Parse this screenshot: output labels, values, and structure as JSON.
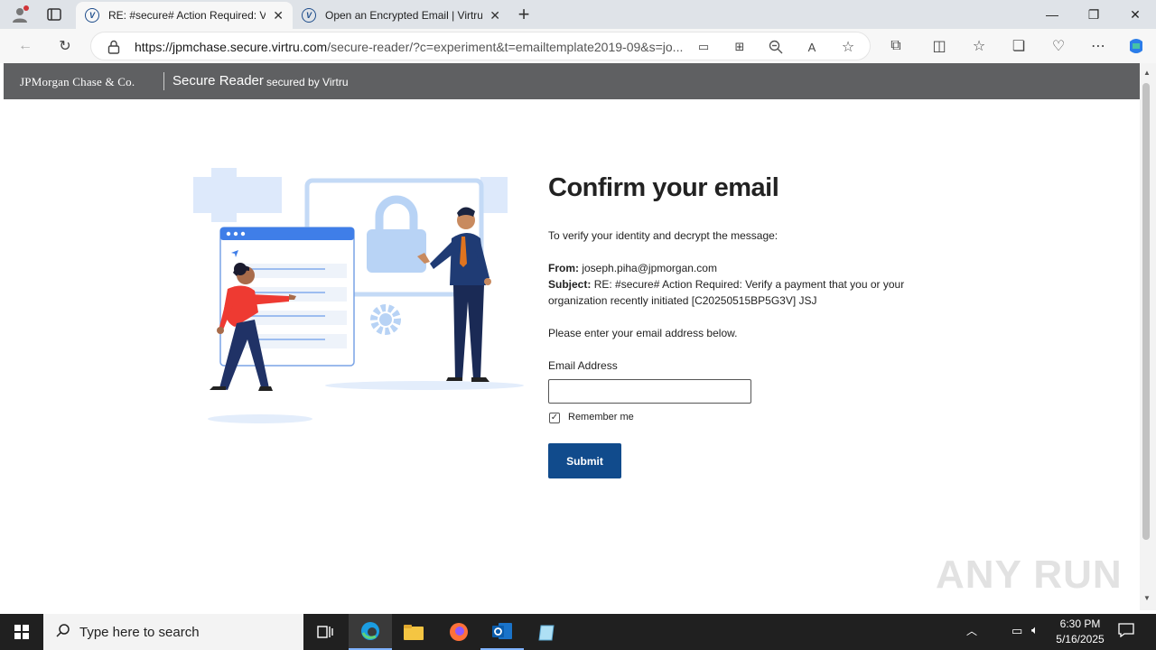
{
  "browser": {
    "tabs": [
      {
        "title": "RE: #secure# Action Required: Ve",
        "active": true
      },
      {
        "title": "Open an Encrypted Email | Virtru",
        "active": false
      }
    ],
    "url_host": "https://jpmchase.secure.virtru.com",
    "url_path": "/secure-reader/?c=experiment&t=emailtemplate2019-09&s=jo..."
  },
  "header": {
    "brand": "JPMorgan Chase & Co.",
    "product": "Secure Reader",
    "secured_by": "secured by Virtru"
  },
  "form": {
    "title": "Confirm your email",
    "intro": "To verify your identity and decrypt the message:",
    "from_label": "From:",
    "from_value": "joseph.piha@jpmorgan.com",
    "subject_label": "Subject:",
    "subject_value": "RE: #secure# Action Required: Verify a payment that you or your organization recently initiated [C20250515BP5G3V] JSJ",
    "prompt": "Please enter your email address below.",
    "email_label": "Email Address",
    "email_value": "",
    "remember_label": "Remember me",
    "remember_checked": true,
    "submit_label": "Submit"
  },
  "watermark": "ANY RUN",
  "taskbar": {
    "search_placeholder": "Type here to search",
    "time": "6:30 PM",
    "date": "5/16/2025"
  },
  "colors": {
    "brand_bar": "#5f6062",
    "submit": "#114b8c",
    "illustration_blue": "#c7dcf7"
  }
}
